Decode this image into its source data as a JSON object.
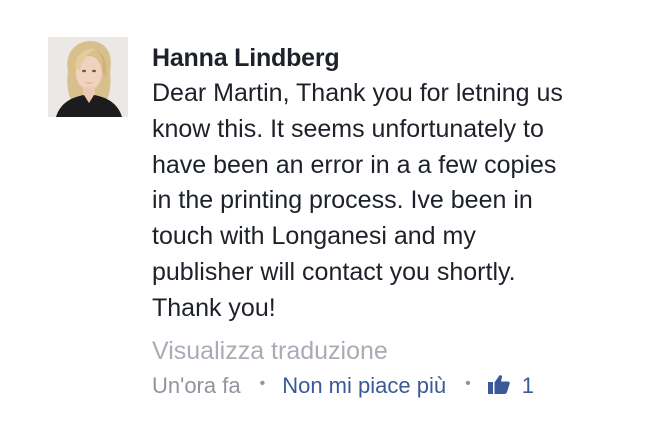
{
  "comment": {
    "author": "Hanna Lindberg",
    "text_lines": [
      "Dear Martin, Thank you for letning us",
      "know this. It seems unfortunately to",
      "have been an error in a a few copies",
      "in the printing process. Ive been in",
      "touch with Longanesi and my",
      "publisher will contact you shortly.",
      "Thank you!"
    ],
    "translate_link": "Visualizza traduzione",
    "timestamp": "Un'ora fa",
    "separator": "•",
    "unlike_label": "Non mi piace più",
    "like_icon": "thumbs-up-icon",
    "like_count": "1"
  },
  "colors": {
    "text": "#1d2129",
    "muted": "#90949c",
    "translate": "#a8adb5",
    "link": "#3b5998"
  }
}
